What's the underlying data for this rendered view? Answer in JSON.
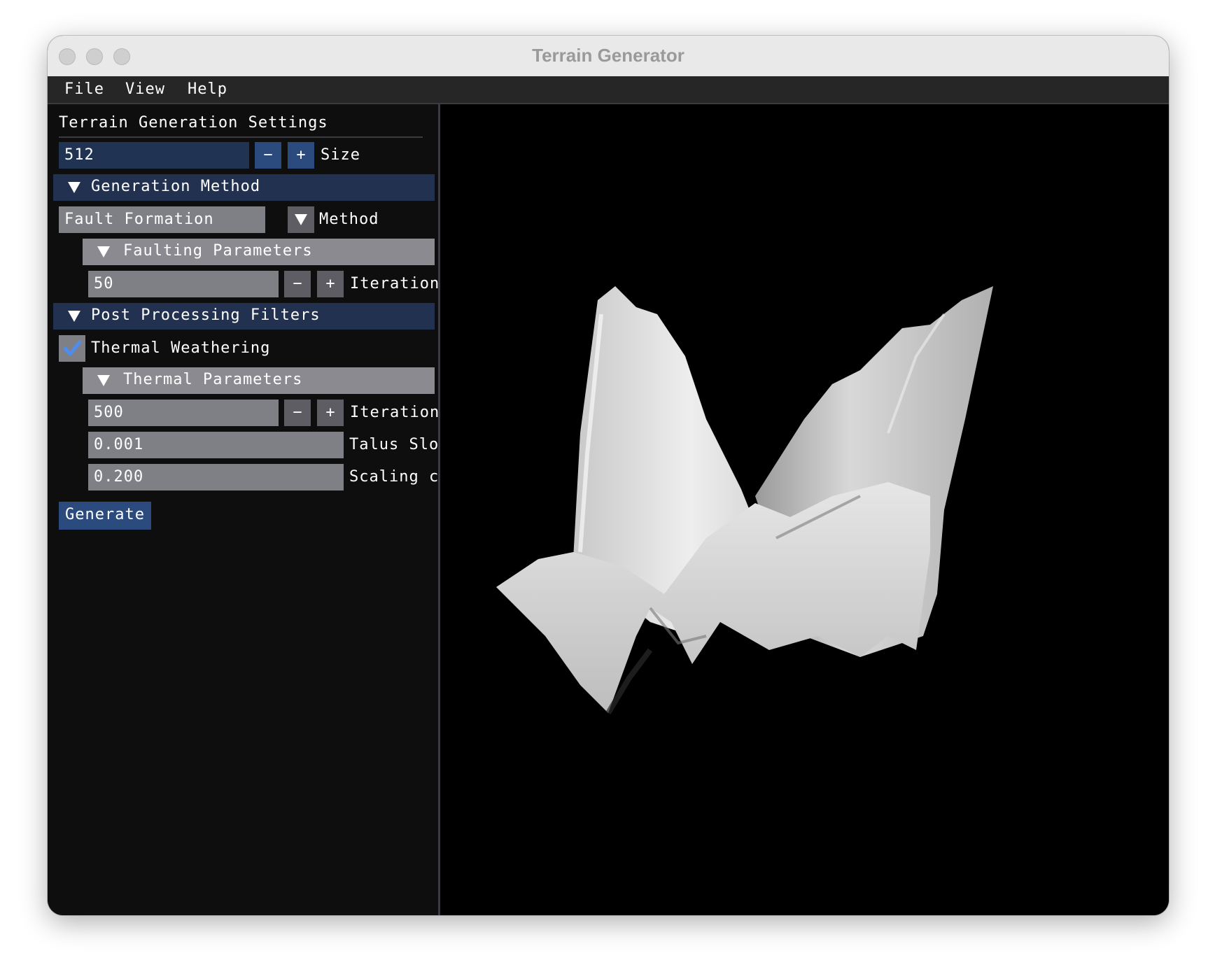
{
  "window": {
    "title": "Terrain Generator"
  },
  "menu": {
    "items": [
      "File",
      "View",
      "Help"
    ]
  },
  "panel": {
    "heading": "Terrain Generation Settings",
    "size": {
      "value": "512",
      "minus": "−",
      "plus": "+",
      "label": "Size"
    },
    "generation_method": {
      "header": "Generation Method",
      "method_value": "Fault Formation",
      "method_label": "Method",
      "faulting": {
        "header": "Faulting Parameters",
        "iterations_value": "50",
        "minus": "−",
        "plus": "+",
        "iterations_label": "Iteration"
      }
    },
    "post_processing": {
      "header": "Post Processing Filters",
      "thermal_checkbox_label": "Thermal Weathering",
      "thermal_checked": true,
      "thermal_params": {
        "header": "Thermal Parameters",
        "iterations_value": "500",
        "minus": "−",
        "plus": "+",
        "iterations_label": "Iteration",
        "talus_value": "0.001",
        "talus_label": "Talus Slo",
        "scaling_value": "0.200",
        "scaling_label": "Scaling c"
      }
    },
    "generate_button": "Generate"
  },
  "colors": {
    "panel_bg": "#0e0e0e",
    "header_blue": "#223150",
    "button_blue": "#2b4a7e",
    "frame_gray": "#7f7f86",
    "check_blue": "#4f8cf0"
  }
}
